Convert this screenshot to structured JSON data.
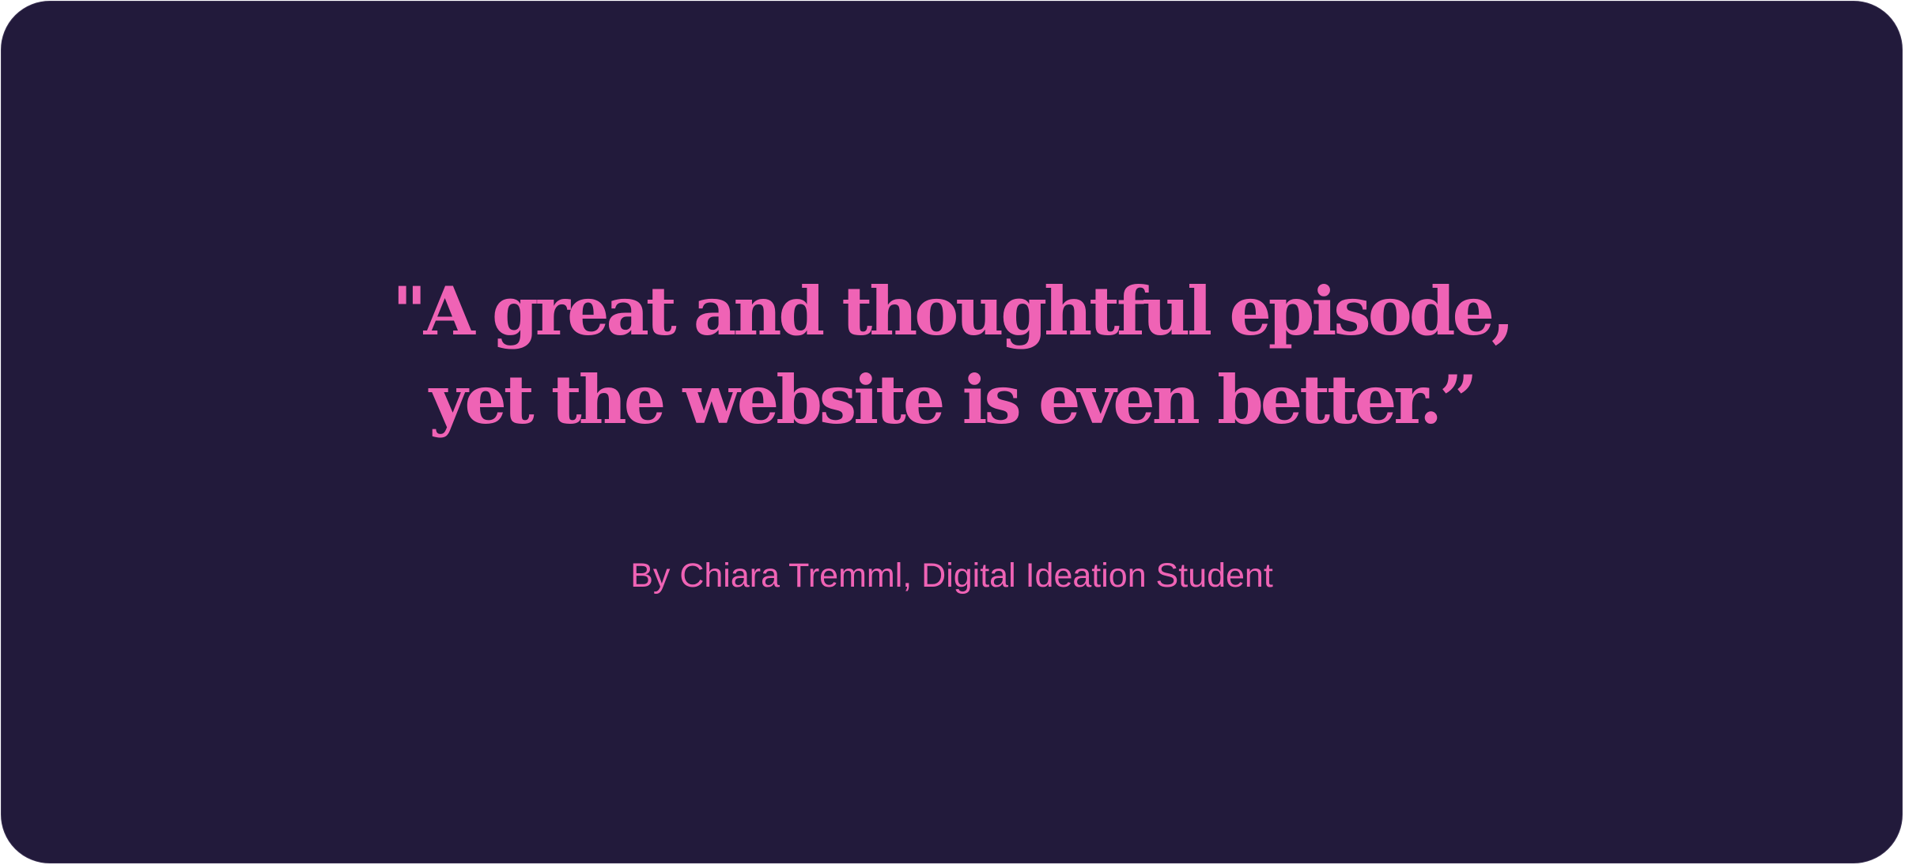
{
  "testimonial": {
    "quote_line_1": "\"A great and thoughtful episode,",
    "quote_line_2": "yet the website is even better.”",
    "byline": "By Chiara Tremml, Digital Ideation Student"
  },
  "colors": {
    "background": "#221a3b",
    "accent": "#ef63b5"
  }
}
